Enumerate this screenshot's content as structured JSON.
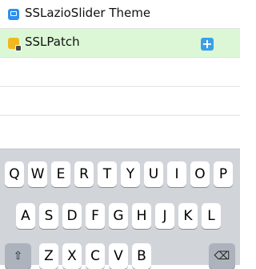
{
  "list": {
    "items": [
      {
        "label": "SSLazioSlider Theme",
        "icon": "app-icon"
      },
      {
        "label": "SSLPatch",
        "icon": "lock-app-icon",
        "action_glyph": "+"
      }
    ]
  },
  "keyboard": {
    "row1": [
      "Q",
      "W",
      "E",
      "R",
      "T",
      "Y",
      "U",
      "I",
      "O",
      "P"
    ],
    "row2": [
      "A",
      "S",
      "D",
      "F",
      "G",
      "H",
      "J",
      "K",
      "L"
    ],
    "row3": [
      "Z",
      "X",
      "C",
      "V",
      "B"
    ],
    "shift_glyph": "⇧",
    "delete_glyph": "⌫"
  },
  "colors": {
    "highlight": "#dcf7d6",
    "add_button": "#3b9ee8",
    "keyboard_bg": "#d1d4d9"
  }
}
